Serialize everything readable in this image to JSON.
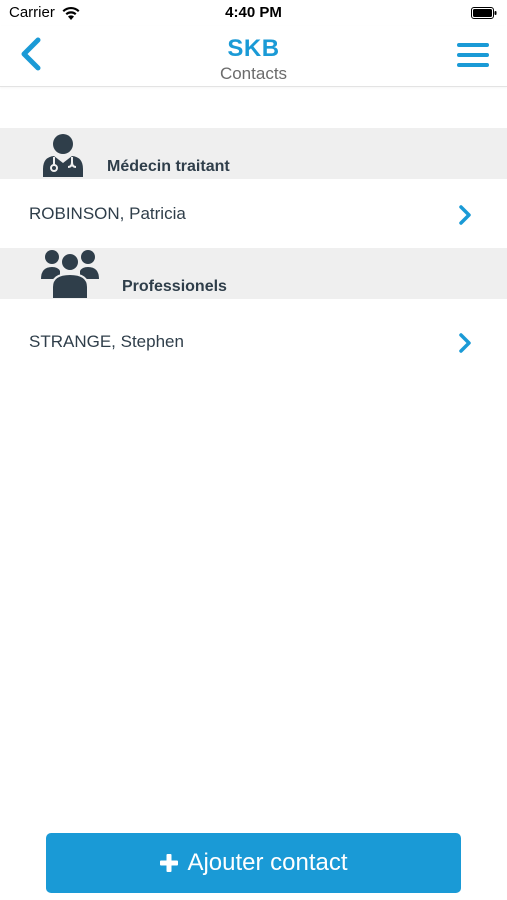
{
  "status_bar": {
    "carrier": "Carrier",
    "time": "4:40 PM"
  },
  "nav": {
    "title": "SKB",
    "subtitle": "Contacts"
  },
  "sections": [
    {
      "label": "Médecin traitant",
      "icon": "doctor-icon",
      "contacts": [
        "ROBINSON, Patricia"
      ]
    },
    {
      "label": "Professionels",
      "icon": "group-icon",
      "contacts": [
        "STRANGE, Stephen"
      ]
    }
  ],
  "add_button": {
    "label": "Ajouter contact"
  },
  "colors": {
    "accent": "#1a9ad6",
    "text": "#2f3e4a",
    "section_bg": "#efefef"
  }
}
